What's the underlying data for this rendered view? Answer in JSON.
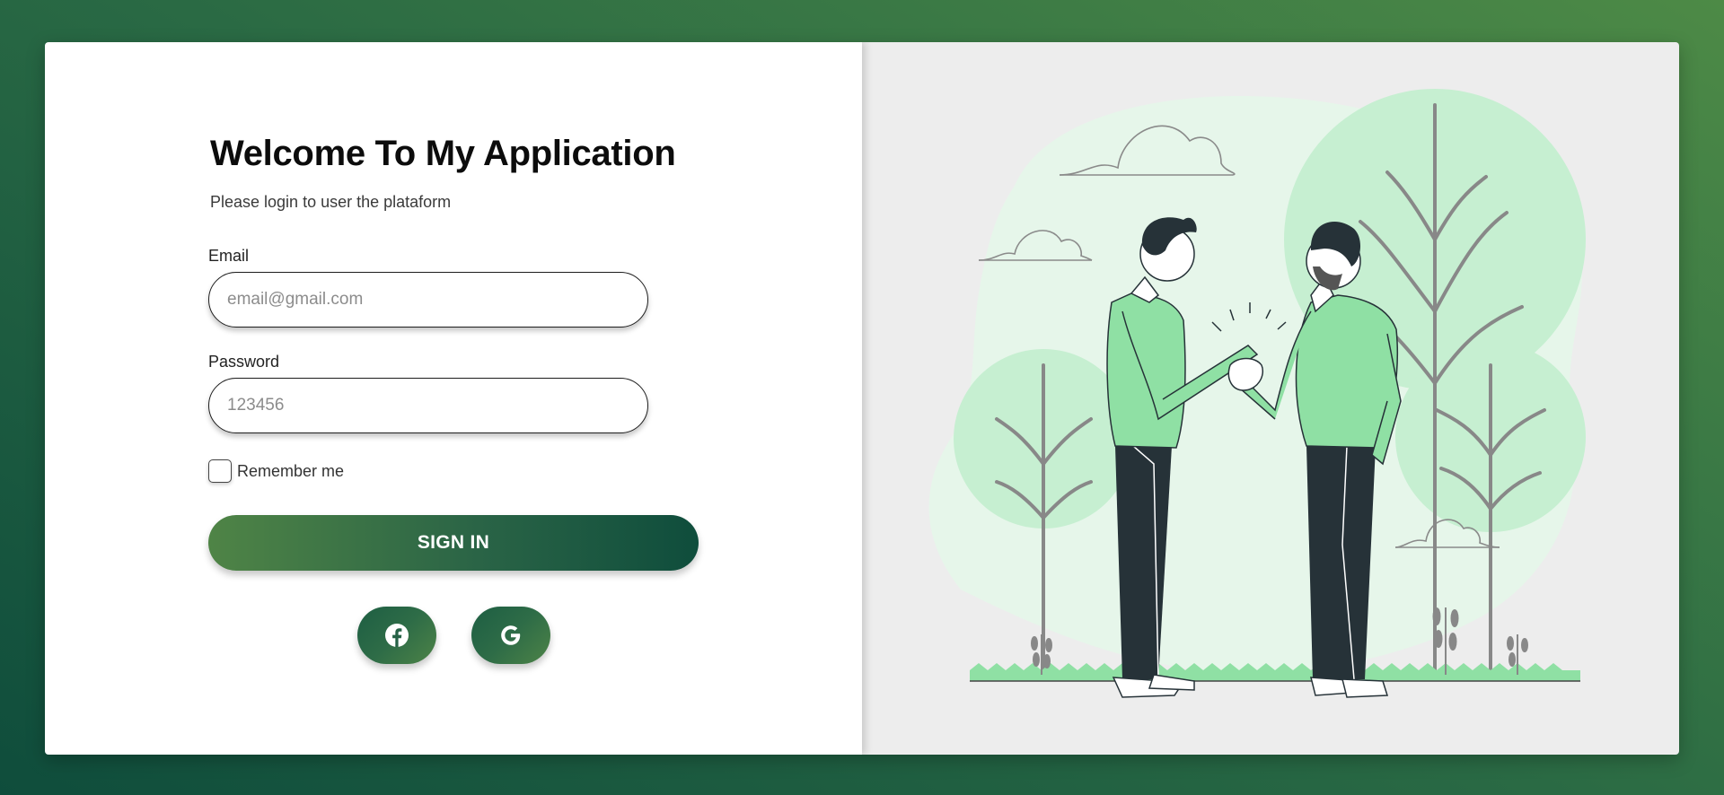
{
  "login": {
    "title": "Welcome To My Application",
    "subtitle": "Please login to user the plataform",
    "email_label": "Email",
    "email_placeholder": "email@gmail.com",
    "password_label": "Password",
    "password_placeholder": "123456",
    "remember_label": "Remember me",
    "remember_checked": false,
    "signin_label": "SIGN IN",
    "social_icons": [
      "facebook-icon",
      "google-icon"
    ]
  },
  "colors": {
    "accent_dark": "#0f4d3c",
    "accent_light": "#4f8446",
    "illustration_green": "#8fe0a4",
    "illustration_bg": "#ededed"
  }
}
